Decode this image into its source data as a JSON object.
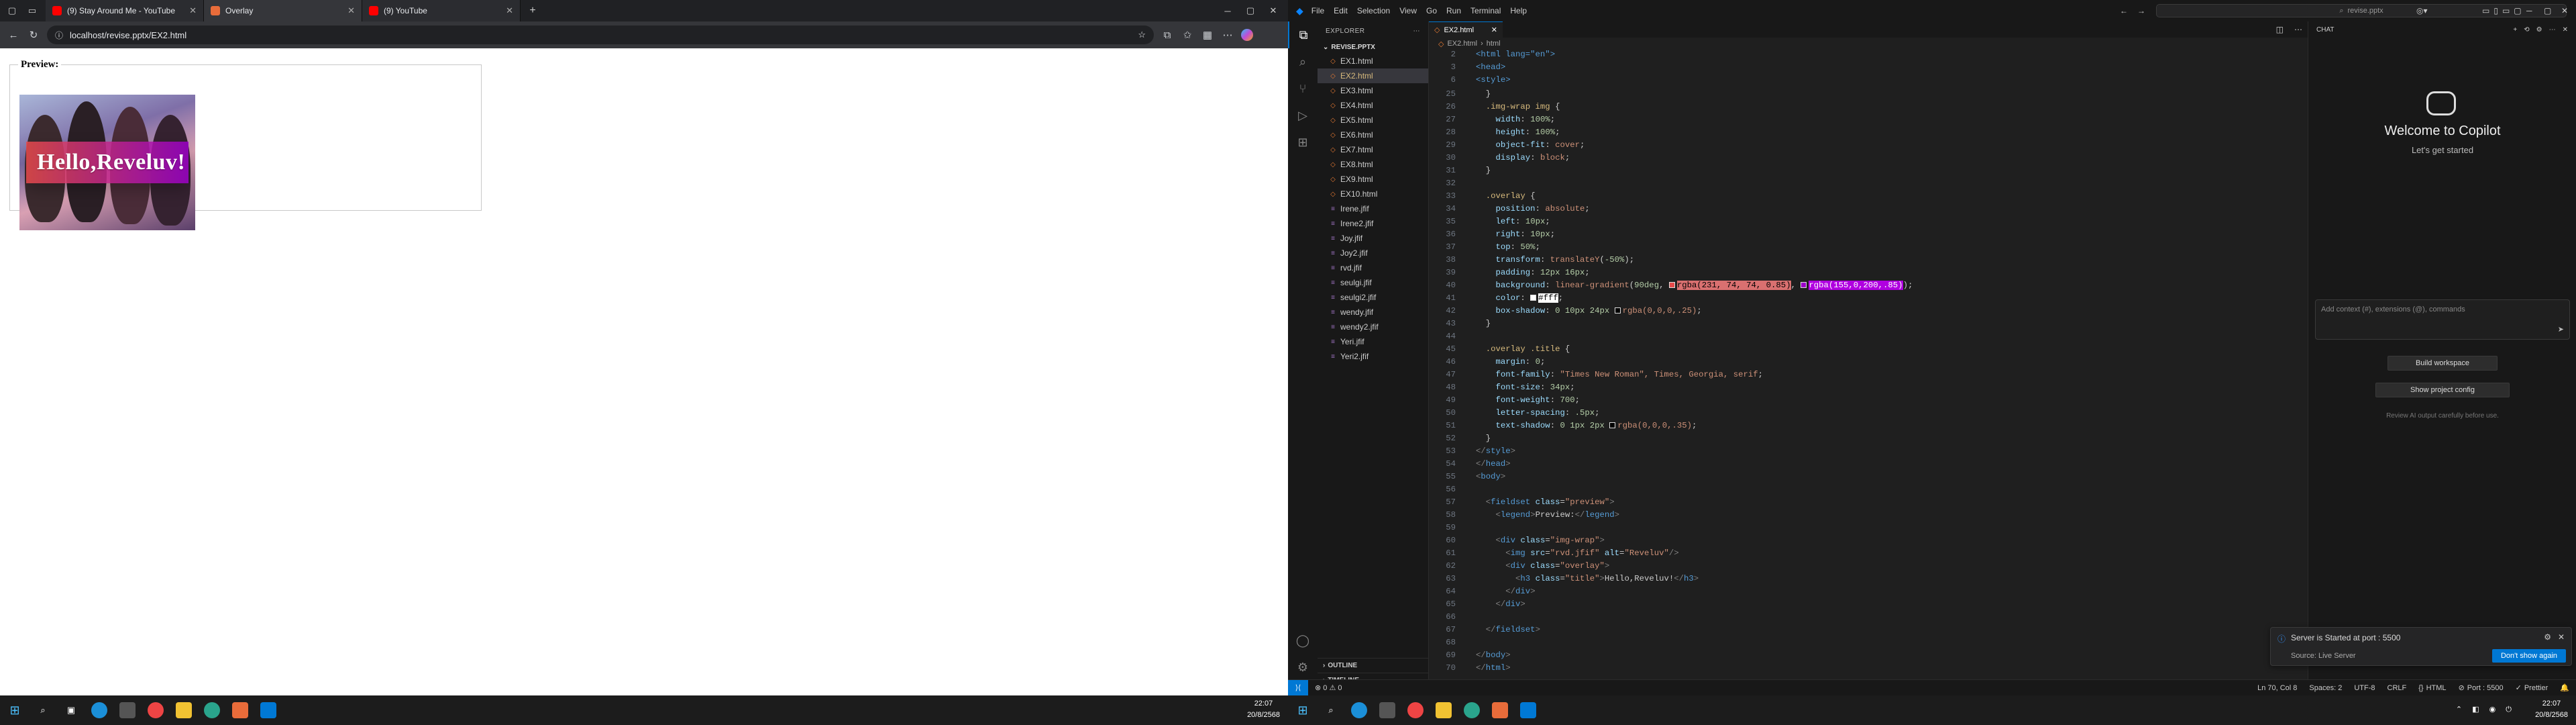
{
  "browser": {
    "tabs": [
      {
        "title": "(9) Stay Around Me - YouTube",
        "favicon": "youtube-icon",
        "color": "#ff0000"
      },
      {
        "title": "Overlay",
        "favicon": "html-file-icon",
        "color": "#e86c3a"
      },
      {
        "title": "(9) YouTube",
        "favicon": "youtube-icon",
        "color": "#ff0000"
      }
    ],
    "url": "localhost/revise.pptx/EX2.html",
    "page": {
      "legend": "Preview:",
      "overlay_title": "Hello,Reveluv!",
      "gradient_start": "#e74a4a",
      "gradient_end": "#9b00c8"
    }
  },
  "taskbar_left": {
    "time": "22:07",
    "date": "20/8/2568"
  },
  "vscode": {
    "menu": [
      "File",
      "Edit",
      "Selection",
      "View",
      "Go",
      "Run",
      "Terminal",
      "Help"
    ],
    "search": "revise.pptx",
    "explorer": {
      "header": "EXPLORER",
      "root": "REVISE.PPTX",
      "files": [
        {
          "name": "EX1.html",
          "type": "html"
        },
        {
          "name": "EX2.html",
          "type": "html"
        },
        {
          "name": "EX3.html",
          "type": "html"
        },
        {
          "name": "EX4.html",
          "type": "html"
        },
        {
          "name": "EX5.html",
          "type": "html"
        },
        {
          "name": "EX6.html",
          "type": "html"
        },
        {
          "name": "EX7.html",
          "type": "html"
        },
        {
          "name": "EX8.html",
          "type": "html"
        },
        {
          "name": "EX9.html",
          "type": "html"
        },
        {
          "name": "EX10.html",
          "type": "html"
        },
        {
          "name": "Irene.jfif",
          "type": "image"
        },
        {
          "name": "Irene2.jfif",
          "type": "image"
        },
        {
          "name": "Joy.jfif",
          "type": "image"
        },
        {
          "name": "Joy2.jfif",
          "type": "image"
        },
        {
          "name": "rvd.jfif",
          "type": "image"
        },
        {
          "name": "seulgi.jfif",
          "type": "image"
        },
        {
          "name": "seulgi2.jfif",
          "type": "image"
        },
        {
          "name": "wendy.jfif",
          "type": "image"
        },
        {
          "name": "wendy2.jfif",
          "type": "image"
        },
        {
          "name": "Yeri.jfif",
          "type": "image"
        },
        {
          "name": "Yeri2.jfif",
          "type": "image"
        }
      ],
      "outline": "OUTLINE",
      "timeline": "TIMELINE"
    },
    "editor": {
      "tab": "EX2.html",
      "breadcrumb": [
        "EX2.html",
        "html"
      ],
      "sticky": [
        {
          "n": "2",
          "code": "<html lang=\"en\">"
        },
        {
          "n": "3",
          "code": "<head>"
        },
        {
          "n": "6",
          "code": "<style>"
        }
      ]
    },
    "chat": {
      "header": "CHAT",
      "welcome": "Welcome to Copilot",
      "subtitle": "Let's get started",
      "input_placeholder": "Add context (#), extensions (@), commands",
      "buttons": [
        "Build workspace",
        "Show project config"
      ],
      "disclaimer": "Review AI output carefully before use."
    },
    "notification": {
      "message": "Server is Started at port : 5500",
      "source": "Source: Live Server",
      "action": "Don't show again"
    },
    "status": {
      "left": "⊗ 0 ⚠ 0",
      "position": "Ln 70, Col 8",
      "spaces": "Spaces: 2",
      "encoding": "UTF-8",
      "eol": "CRLF",
      "language": "HTML",
      "port": "Port : 5500",
      "prettier": "Prettier"
    }
  },
  "taskbar_right": {
    "time": "22:07",
    "date": "20/8/2568"
  }
}
